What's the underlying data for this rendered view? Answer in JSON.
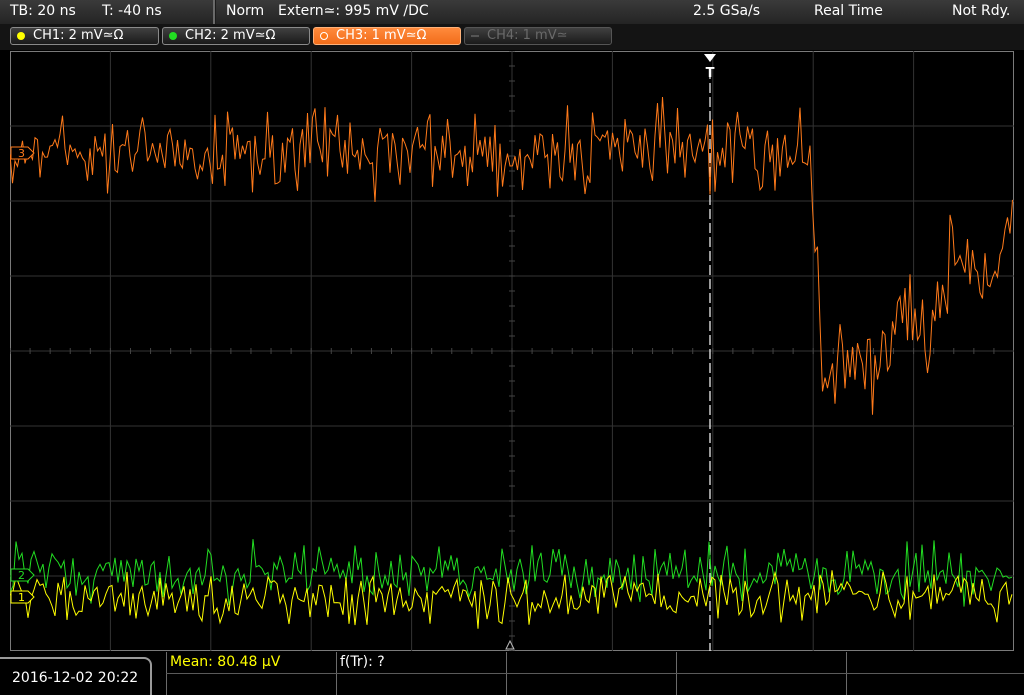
{
  "topbar": {
    "timebase": "TB: 20 ns",
    "trigger_time": "T: -40 ns",
    "mode": "Norm",
    "trigger_source": "Extern≃: 995 mV ∕DC",
    "sample_rate": "2.5 GSa/s",
    "acq_mode": "Real Time",
    "status": "Not Rdy."
  },
  "channels": [
    {
      "label": "CH1: 2 mV≃Ω",
      "color": "#ffff00",
      "state": "on"
    },
    {
      "label": "CH2: 2 mV≃Ω",
      "color": "#22dd22",
      "state": "on"
    },
    {
      "label": "CH3: 1 mV≃Ω",
      "color": "#ff7a1a",
      "state": "selected"
    },
    {
      "label": "CH4: 1 mV≃",
      "color": "#666666",
      "state": "off"
    }
  ],
  "markers": {
    "trigger": "T",
    "ch3": "3",
    "ch2": "2",
    "ch1": "1"
  },
  "bottom": {
    "datetime": "2016-12-02 20:22",
    "mean": "Mean: 80.48 µV",
    "ftr": "f(Tr): ?"
  },
  "colors": {
    "ch1": "#ffff00",
    "ch2": "#22dd22",
    "ch3": "#ff7a1a",
    "grid": "#3a3a3a",
    "background": "#000000"
  }
}
